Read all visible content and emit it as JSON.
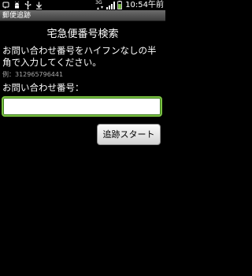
{
  "status_bar": {
    "icons": [
      "notification-icon",
      "android-debug-icon",
      "usb-icon",
      "download-icon"
    ],
    "network_label": "3G",
    "clock": "10:54午前"
  },
  "title_bar": {
    "title": "郵便追跡"
  },
  "main": {
    "heading": "宅急便番号検索",
    "instruction": "お問い合わせ番号をハイフンなしの半角で入力してください。",
    "example": "例：312965796441",
    "field_label": "お問い合わせ番号：",
    "input_value": "",
    "button_label": "追跡スタート"
  },
  "colors": {
    "background": "#000000",
    "input_focus_border": "#7ac142",
    "example_text": "#a8a8a8"
  }
}
